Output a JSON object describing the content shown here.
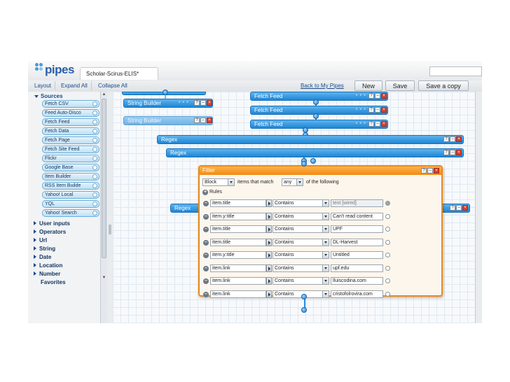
{
  "header": {
    "logo_text": "pipes",
    "pipe_tab": "Scholar-Scirus-ELIS*",
    "back_link": "Back to My Pipes",
    "new_button": "New",
    "save_button": "Save",
    "save_copy_button": "Save a copy"
  },
  "toolbar": {
    "layout": "Layout",
    "expand_all": "Expand All",
    "collapse_all": "Collapse All"
  },
  "sidebar": {
    "sources_heading": "Sources",
    "sources": [
      "Fetch CSV",
      "Feed Auto-Disco",
      "Fetch Feed",
      "Fetch Data",
      "Fetch Page",
      "Fetch Site Feed",
      "Flickr",
      "Google Base",
      "Item Builder",
      "RSS Item Builde",
      "Yahoo! Local",
      "YQL",
      "Yahoo! Search"
    ],
    "categories": [
      "User inputs",
      "Operators",
      "Url",
      "String",
      "Date",
      "Location",
      "Number",
      "Favorites"
    ]
  },
  "canvas": {
    "modules": {
      "string_builder_1": "String Builder",
      "string_builder_2": "String Builder",
      "fetch_feed_1": "Fetch Feed",
      "fetch_feed_2": "Fetch Feed",
      "fetch_feed_3": "Fetch Feed",
      "regex_1": "Regex",
      "regex_2": "Regex",
      "regex_3": "Regex"
    },
    "filter": {
      "title": "Filter",
      "mode": "Block",
      "items_that_match": "items that match",
      "match": "any",
      "of_following": "of the following",
      "rules_label": "Rules",
      "rules": [
        {
          "field": "item.title",
          "op": "Contains",
          "value": "text [wired]"
        },
        {
          "field": "item.y:title",
          "op": "Contains",
          "value": "Can't read content"
        },
        {
          "field": "item.title",
          "op": "Contains",
          "value": "UPF"
        },
        {
          "field": "item.title",
          "op": "Contains",
          "value": "DL-Harvest"
        },
        {
          "field": "item.y:title",
          "op": "Contains",
          "value": "Untitled"
        },
        {
          "field": "item.link",
          "op": "Contains",
          "value": "upf.edu"
        },
        {
          "field": "item.link",
          "op": "Contains",
          "value": "lluiscodina.com"
        },
        {
          "field": "item.link",
          "op": "Contains",
          "value": "cristofolrovira.com"
        }
      ]
    }
  },
  "colors": {
    "module_blue": "#1e86d6",
    "filter_orange": "#f38a12",
    "close_red": "#d9412f",
    "link_blue": "#1a4b8f"
  },
  "icons": {
    "module_controls": [
      "help-icon",
      "minimize-icon",
      "close-icon"
    ],
    "rule_remove": "minus-circle-icon",
    "rule_add": "plus-circle-icon"
  }
}
